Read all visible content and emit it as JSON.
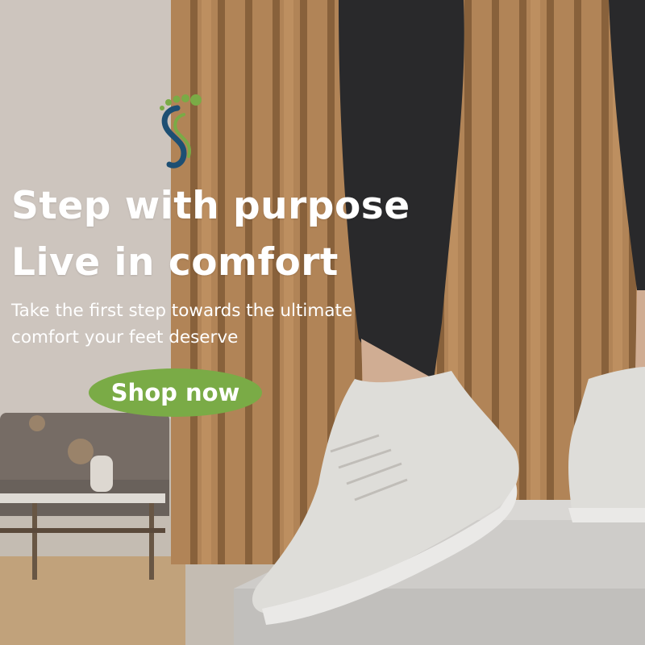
{
  "brand": {
    "logo_icon": "footprint-s-logo-icon",
    "accent_color": "#7aab46",
    "logo_blue": "#1d4f73"
  },
  "hero": {
    "headline_line1": "Step with purpose",
    "headline_line2": "Live in comfort",
    "subtext_line1": "Take the first step towards the ultimate",
    "subtext_line2": "comfort your feet deserve"
  },
  "cta": {
    "label": "Shop now",
    "color": "#7aab46"
  }
}
